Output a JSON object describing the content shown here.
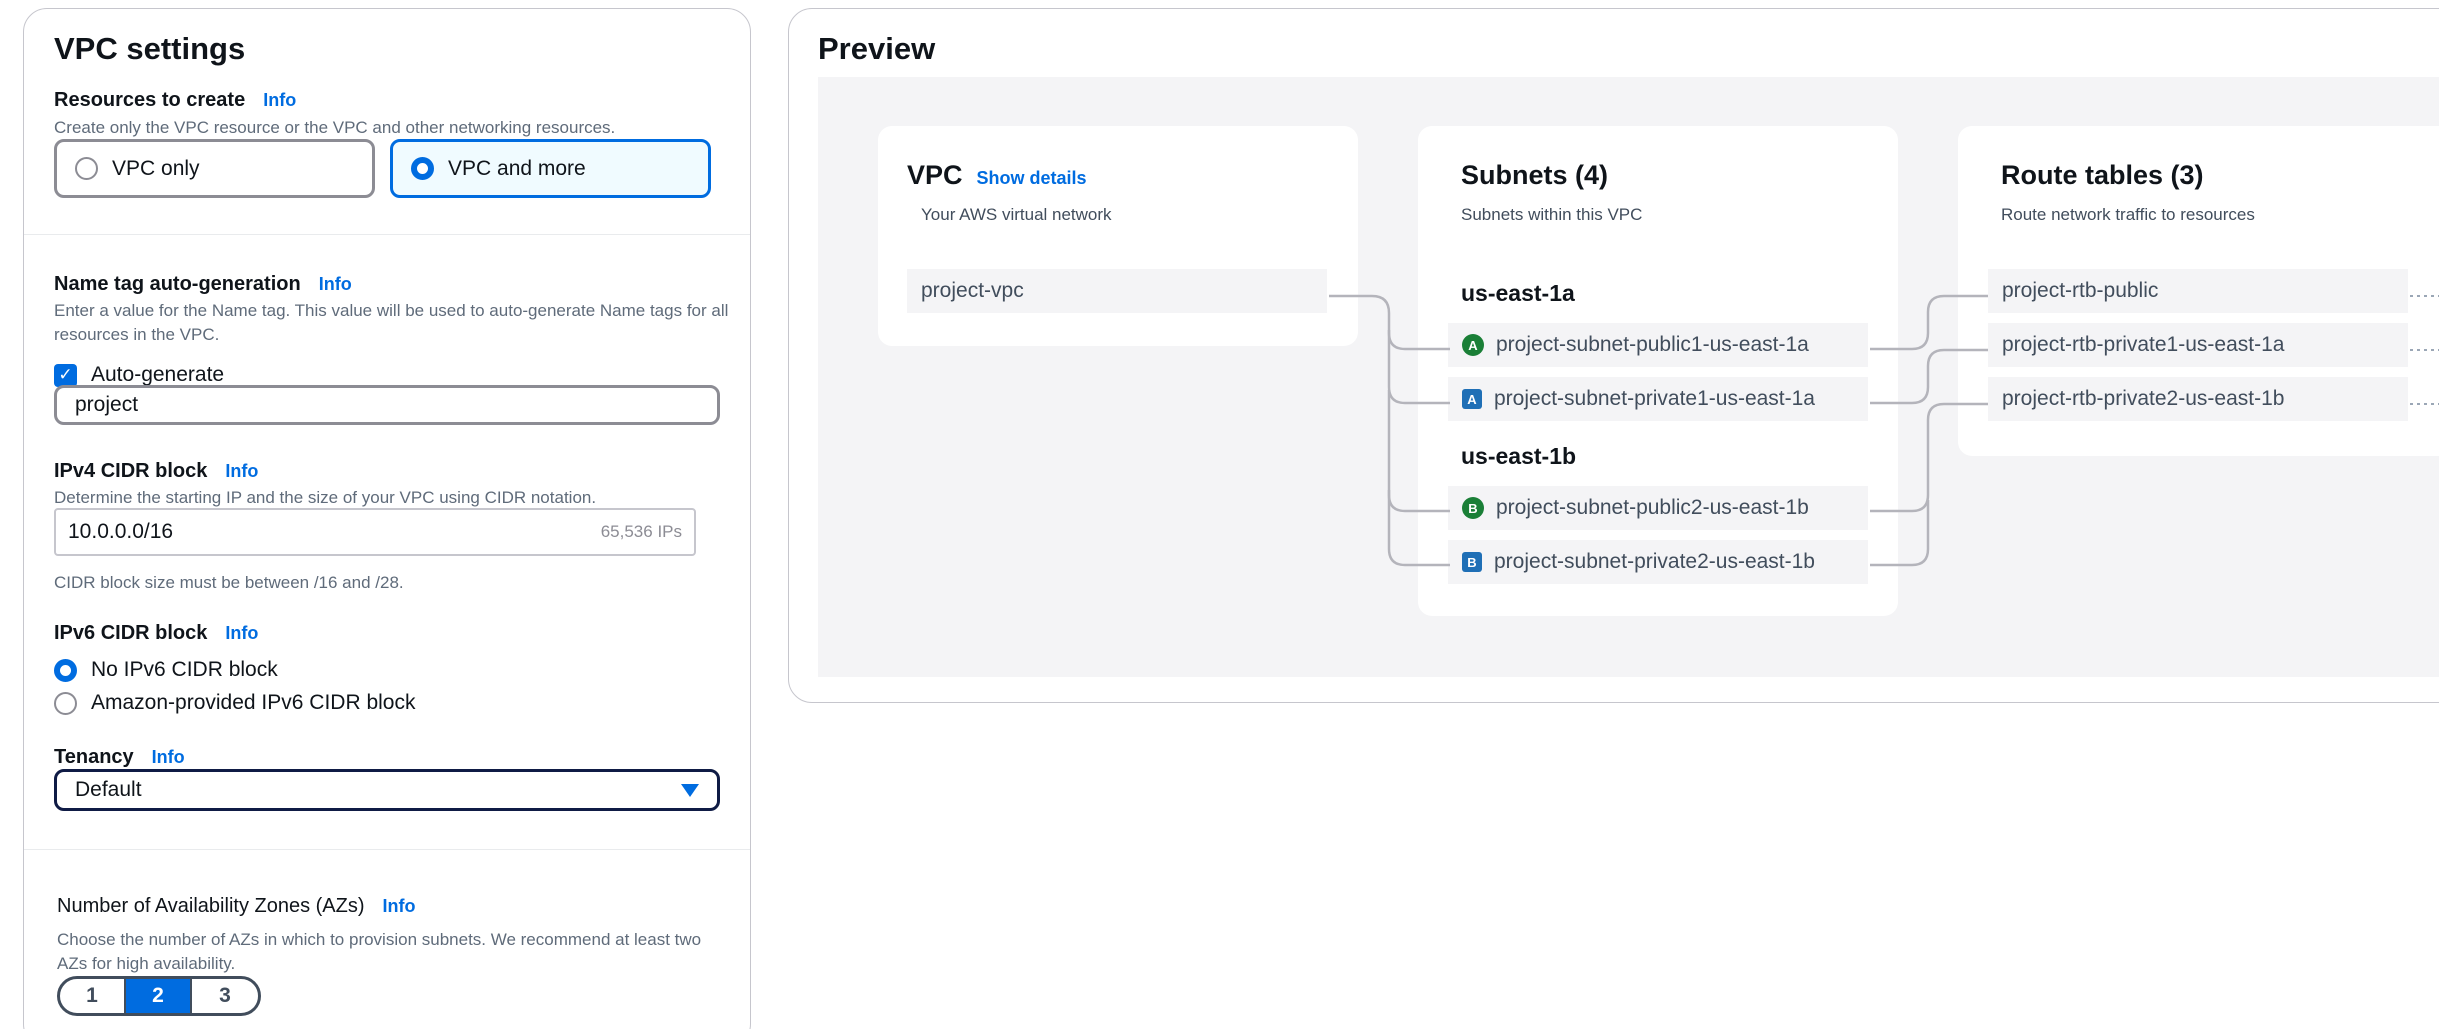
{
  "vpc_settings": {
    "title": "VPC settings",
    "resources": {
      "label": "Resources to create",
      "info": "Info",
      "description": "Create only the VPC resource or the VPC and other networking resources.",
      "option_vpc_only": "VPC only",
      "option_vpc_and_more": "VPC and more",
      "selected": "VPC and more"
    },
    "name_tag": {
      "label": "Name tag auto-generation",
      "info": "Info",
      "description": "Enter a value for the Name tag. This value will be used to auto-generate Name tags for all resources in the VPC.",
      "auto_generate_label": "Auto-generate",
      "auto_generate_checked": true,
      "value": "project"
    },
    "ipv4": {
      "label": "IPv4 CIDR block",
      "info": "Info",
      "description": "Determine the starting IP and the size of your VPC using CIDR notation.",
      "value": "10.0.0.0/16",
      "ip_count": "65,536 IPs",
      "constraint": "CIDR block size must be between /16 and /28."
    },
    "ipv6": {
      "label": "IPv6 CIDR block",
      "info": "Info",
      "option_none": "No IPv6 CIDR block",
      "option_amazon": "Amazon-provided IPv6 CIDR block",
      "selected": "No IPv6 CIDR block"
    },
    "tenancy": {
      "label": "Tenancy",
      "info": "Info",
      "value": "Default"
    },
    "azs": {
      "label": "Number of Availability Zones (AZs)",
      "info": "Info",
      "description": "Choose the number of AZs in which to provision subnets. We recommend at least two AZs for high availability.",
      "options": [
        "1",
        "2",
        "3"
      ],
      "selected": "2"
    }
  },
  "preview": {
    "title": "Preview",
    "vpc": {
      "title": "VPC",
      "show_details": "Show details",
      "subtitle": "Your AWS virtual network",
      "name": "project-vpc"
    },
    "subnets": {
      "title": "Subnets (4)",
      "subtitle": "Subnets within this VPC",
      "zones": [
        {
          "name": "us-east-1a",
          "items": [
            {
              "badge": "A",
              "type": "public",
              "name": "project-subnet-public1-us-east-1a"
            },
            {
              "badge": "A",
              "type": "private",
              "name": "project-subnet-private1-us-east-1a"
            }
          ]
        },
        {
          "name": "us-east-1b",
          "items": [
            {
              "badge": "B",
              "type": "public",
              "name": "project-subnet-public2-us-east-1b"
            },
            {
              "badge": "B",
              "type": "private",
              "name": "project-subnet-private2-us-east-1b"
            }
          ]
        }
      ]
    },
    "route_tables": {
      "title": "Route tables (3)",
      "subtitle": "Route network traffic to resources",
      "items": [
        "project-rtb-public",
        "project-rtb-private1-us-east-1a",
        "project-rtb-private2-us-east-1b"
      ]
    }
  },
  "colors": {
    "accent": "#006ce0",
    "public_badge": "#1a7f37",
    "private_badge": "#1f6fb6"
  }
}
